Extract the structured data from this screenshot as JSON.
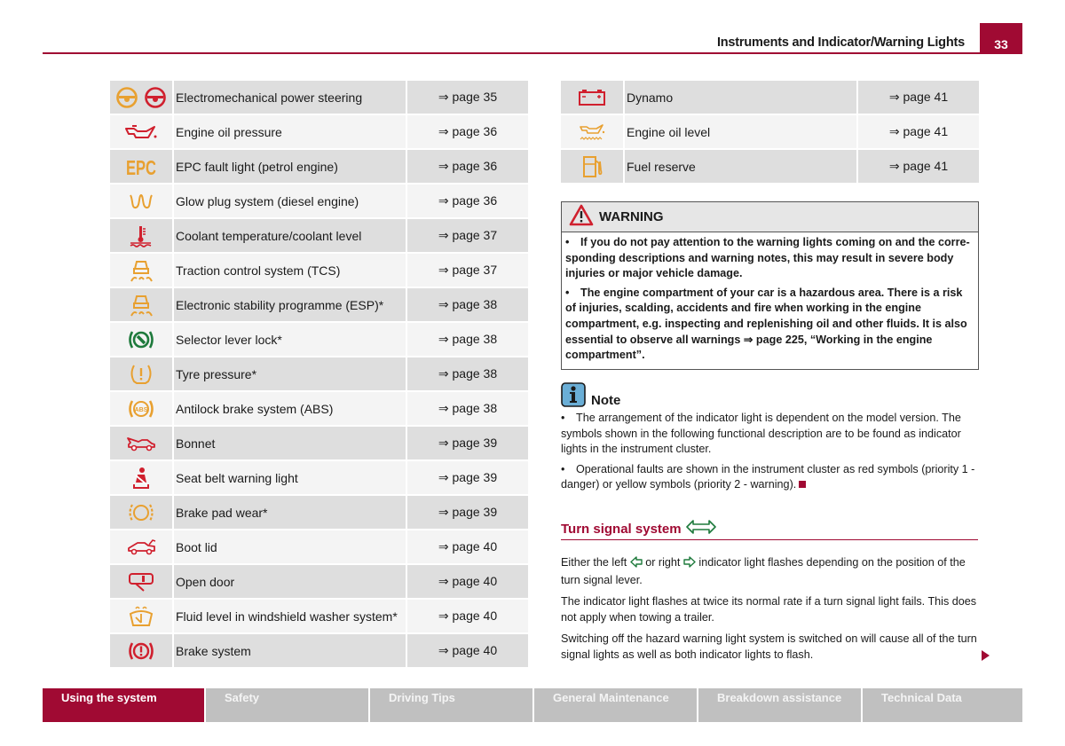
{
  "header": {
    "title": "Instruments and Indicator/Warning Lights",
    "page_number": "33"
  },
  "colors": {
    "brand": "#a00a33",
    "amber": "#e8a030",
    "red": "#d0202e",
    "green": "#1e7a3c"
  },
  "left_table": [
    {
      "icon": "power-steering-icons",
      "label": "Electromechanical power steering",
      "page": "⇒ page 35"
    },
    {
      "icon": "oil-can-icon",
      "label": "Engine oil pressure",
      "page": "⇒ page 36"
    },
    {
      "icon": "epc-icon",
      "label": "EPC fault light (petrol engine)",
      "page": "⇒ page 36",
      "icon_text": "EPC"
    },
    {
      "icon": "glow-plug-icon",
      "label": "Glow plug system (diesel engine)",
      "page": "⇒ page 36"
    },
    {
      "icon": "coolant-icon",
      "label": "Coolant temperature/coolant level",
      "page": "⇒ page 37"
    },
    {
      "icon": "traction-control-icon",
      "label": "Traction control system (TCS)",
      "page": "⇒ page 37"
    },
    {
      "icon": "esp-icon",
      "label": "Electronic stability programme (ESP)*",
      "page": "⇒ page 38"
    },
    {
      "icon": "selector-lever-lock-icon",
      "label": "Selector lever lock*",
      "page": "⇒ page 38"
    },
    {
      "icon": "tyre-pressure-icon",
      "label": "Tyre pressure*",
      "page": "⇒ page 38"
    },
    {
      "icon": "abs-icon",
      "label": "Antilock brake system (ABS)",
      "page": "⇒ page 38",
      "icon_text": "ABS"
    },
    {
      "icon": "bonnet-icon",
      "label": "Bonnet",
      "page": "⇒ page 39"
    },
    {
      "icon": "seat-belt-icon",
      "label": "Seat belt warning light",
      "page": "⇒ page 39"
    },
    {
      "icon": "brake-pad-icon",
      "label": "Brake pad wear*",
      "page": "⇒ page 39"
    },
    {
      "icon": "boot-lid-icon",
      "label": "Boot lid",
      "page": "⇒ page 40"
    },
    {
      "icon": "open-door-icon",
      "label": "Open door",
      "page": "⇒ page 40"
    },
    {
      "icon": "washer-fluid-icon",
      "label": "Fluid level in windshield washer system*",
      "page": "⇒ page 40"
    },
    {
      "icon": "brake-system-icon",
      "label": "Brake system",
      "page": "⇒ page 40"
    }
  ],
  "right_table": [
    {
      "icon": "battery-icon",
      "label": "Dynamo",
      "page": "⇒ page 41"
    },
    {
      "icon": "oil-level-icon",
      "label": "Engine oil level",
      "page": "⇒ page 41"
    },
    {
      "icon": "fuel-pump-icon",
      "label": "Fuel reserve",
      "page": "⇒ page 41"
    }
  ],
  "warning": {
    "title": "WARNING",
    "items": [
      "• If you do not pay attention to the warning lights coming on and the corre-sponding descriptions and warning notes, this may result in severe body injuries or major vehicle damage.",
      "• The engine compartment of your car is a hazardous area. There is a risk of injuries, scalding, accidents and fire when working in the engine compartment, e.g. inspecting and replenishing oil and other fluids. It is also essential to observe all warnings ⇒ page 225, “Working in the engine compartment”."
    ]
  },
  "note": {
    "title": "Note",
    "items": [
      "• The arrangement of the indicator light is dependent on the model version. The symbols shown in the following functional description are to be found as indicator lights in the instrument cluster.",
      "• Operational faults are shown in the instrument cluster as red symbols (priority 1 - danger) or yellow symbols (priority 2 - warning)."
    ]
  },
  "turn_signal": {
    "title": "Turn signal system",
    "p1_a": "Either the left ",
    "p1_b": " or right ",
    "p1_c": " indicator light flashes depending on the position of the turn signal lever.",
    "p2": "The indicator light flashes at twice its normal rate if a turn signal light fails. This does not apply when towing a trailer.",
    "p3": "Switching off the hazard warning light system is switched on will cause all of the turn signal lights as well as both indicator lights to flash."
  },
  "footer_tabs": [
    {
      "label": "Using the system",
      "active": true
    },
    {
      "label": "Safety",
      "active": false
    },
    {
      "label": "Driving Tips",
      "active": false
    },
    {
      "label": "General Maintenance",
      "active": false
    },
    {
      "label": "Breakdown assistance",
      "active": false
    },
    {
      "label": "Technical Data",
      "active": false
    }
  ]
}
